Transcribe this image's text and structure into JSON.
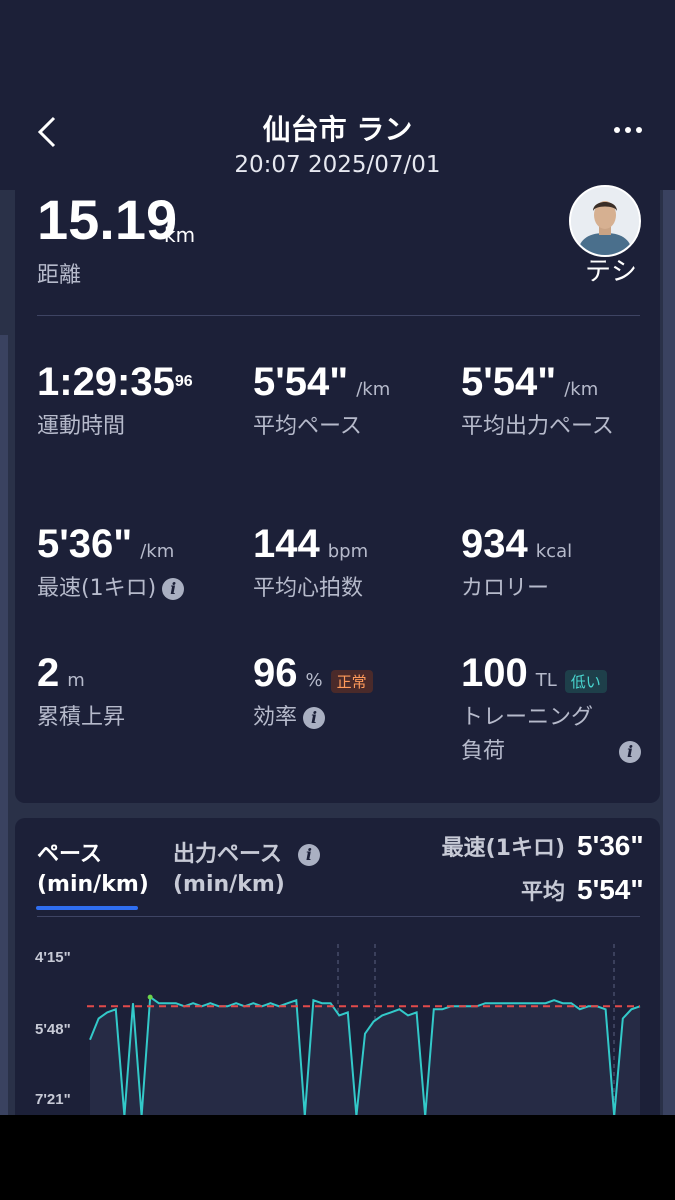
{
  "header": {
    "title": "仙台市 ラン",
    "subtitle": "20:07 2025/07/01",
    "back_icon": "chevron-left-icon",
    "more_icon": "more-horizontal-icon"
  },
  "summary": {
    "distance_value": "15.19",
    "distance_unit": "km",
    "distance_label": "距離",
    "avatar_name": "テシ"
  },
  "stats": [
    {
      "value": "1:29:35",
      "sup": "96",
      "unit": "",
      "label": "運動時間"
    },
    {
      "value": "5'54\"",
      "unit": "/km",
      "label": "平均ペース"
    },
    {
      "value": "5'54\"",
      "unit": "/km",
      "label": "平均出力ペース"
    },
    {
      "value": "5'36\"",
      "unit": "/km",
      "label": "最速(1キロ)"
    },
    {
      "value": "144",
      "unit": "bpm",
      "label": "平均心拍数"
    },
    {
      "value": "934",
      "unit": "kcal",
      "label": "カロリー"
    },
    {
      "value": "2",
      "unit": "m",
      "label": "累積上昇"
    },
    {
      "value": "96",
      "unit": "%",
      "label": "効率",
      "badge": "正常"
    },
    {
      "value": "100",
      "unit": "TL",
      "label": "トレーニング負荷",
      "badge": "低い"
    }
  ],
  "chart_section": {
    "tab_active_line1": "ペース",
    "tab_active_line2": "(min/km)",
    "tab_inactive_line1": "出力ペース",
    "tab_inactive_line2": "(min/km)",
    "fastest_label": "最速(1キロ)",
    "fastest_value": "5'36\"",
    "avg_label": "平均",
    "avg_value": "5'54\""
  },
  "colors": {
    "accent": "#2f6ef0",
    "line": "#33c9c9",
    "fast": "#6cd34a",
    "avg_line": "#e24a4a"
  },
  "chart_data": {
    "type": "line",
    "y_tick_labels": [
      "4'15\"",
      "5'48\"",
      "7'21\""
    ],
    "y_reversed": true,
    "avg_line_label": "5'54\"",
    "series": [
      {
        "values": [
          7.0,
          6.3,
          6.1,
          6.0,
          9.5,
          5.8,
          9.5,
          5.6,
          5.8,
          5.8,
          5.8,
          5.9,
          5.8,
          5.9,
          5.8,
          5.9,
          5.9,
          5.8,
          5.9,
          5.8,
          5.9,
          5.8,
          5.9,
          5.8,
          5.7,
          9.5,
          5.7,
          5.8,
          5.8,
          6.2,
          6.1,
          9.5,
          6.8,
          6.4,
          6.2,
          6.1,
          6.0,
          6.2,
          6.1,
          9.5,
          6.0,
          6.0,
          5.9,
          5.9,
          5.9,
          5.9,
          5.8,
          5.8,
          5.8,
          5.8,
          5.8,
          5.8,
          5.8,
          5.8,
          5.7,
          5.8,
          5.8,
          6.0,
          5.9,
          5.9,
          6.0,
          9.5,
          6.3,
          6.0,
          5.9
        ]
      }
    ]
  }
}
